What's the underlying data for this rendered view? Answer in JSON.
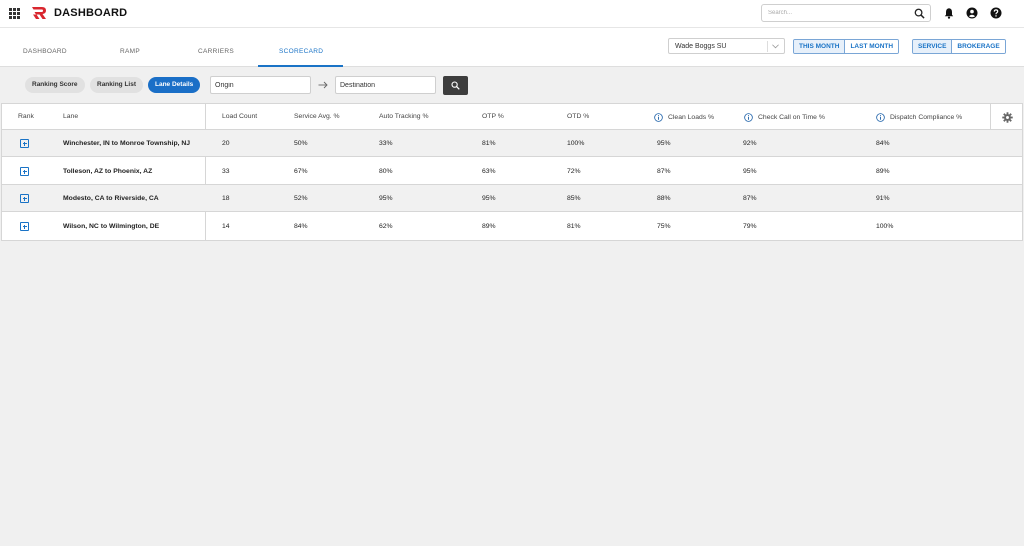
{
  "header": {
    "title": "DASHBOARD",
    "search_placeholder": "Search...",
    "brand_color": "#d9262e"
  },
  "nav": {
    "tabs": [
      {
        "label": "DASHBOARD",
        "active": false
      },
      {
        "label": "RAMP",
        "active": false
      },
      {
        "label": "CARRIERS",
        "active": false
      },
      {
        "label": "SCORECARD",
        "active": true
      }
    ],
    "account_select": "Wade Boggs SU",
    "period_options": [
      "THIS MONTH",
      "LAST MONTH"
    ],
    "selected_period": "THIS MONTH",
    "mode_options": [
      "SERVICE",
      "BROKERAGE"
    ],
    "selected_mode": "SERVICE"
  },
  "filters": {
    "pills": [
      {
        "label": "Ranking Score",
        "active": false
      },
      {
        "label": "Ranking List",
        "active": false
      },
      {
        "label": "Lane Details",
        "active": true
      }
    ],
    "origin_placeholder": "Origin",
    "destination_placeholder": "Destination"
  },
  "table": {
    "columns": [
      "Rank",
      "Lane",
      "Load Count",
      "Service Avg. %",
      "Auto Tracking %",
      "OTP %",
      "OTD %",
      "Clean Loads %",
      "Check Call on Time %",
      "Dispatch Compliance %"
    ],
    "info_columns": [
      7,
      8,
      9
    ],
    "rows": [
      {
        "lane": "Winchester, IN to Monroe Township, NJ",
        "load_count": "20",
        "service_avg": "50%",
        "auto_tracking": "33%",
        "otp": "81%",
        "otd": "100%",
        "clean_loads": "95%",
        "check_call": "92%",
        "dispatch": "84%"
      },
      {
        "lane": "Tolleson, AZ to Phoenix, AZ",
        "load_count": "33",
        "service_avg": "67%",
        "auto_tracking": "80%",
        "otp": "63%",
        "otd": "72%",
        "clean_loads": "87%",
        "check_call": "95%",
        "dispatch": "89%"
      },
      {
        "lane": "Modesto, CA to Riverside, CA",
        "load_count": "18",
        "service_avg": "52%",
        "auto_tracking": "95%",
        "otp": "95%",
        "otd": "85%",
        "clean_loads": "88%",
        "check_call": "87%",
        "dispatch": "91%"
      },
      {
        "lane": "Wilson, NC to Wilmington, DE",
        "load_count": "14",
        "service_avg": "84%",
        "auto_tracking": "62%",
        "otp": "89%",
        "otd": "81%",
        "clean_loads": "75%",
        "check_call": "79%",
        "dispatch": "100%"
      }
    ]
  },
  "colors": {
    "accent": "#1a73c6",
    "active_pill": "#1a6fc7",
    "search_button": "#3d3d3d"
  }
}
